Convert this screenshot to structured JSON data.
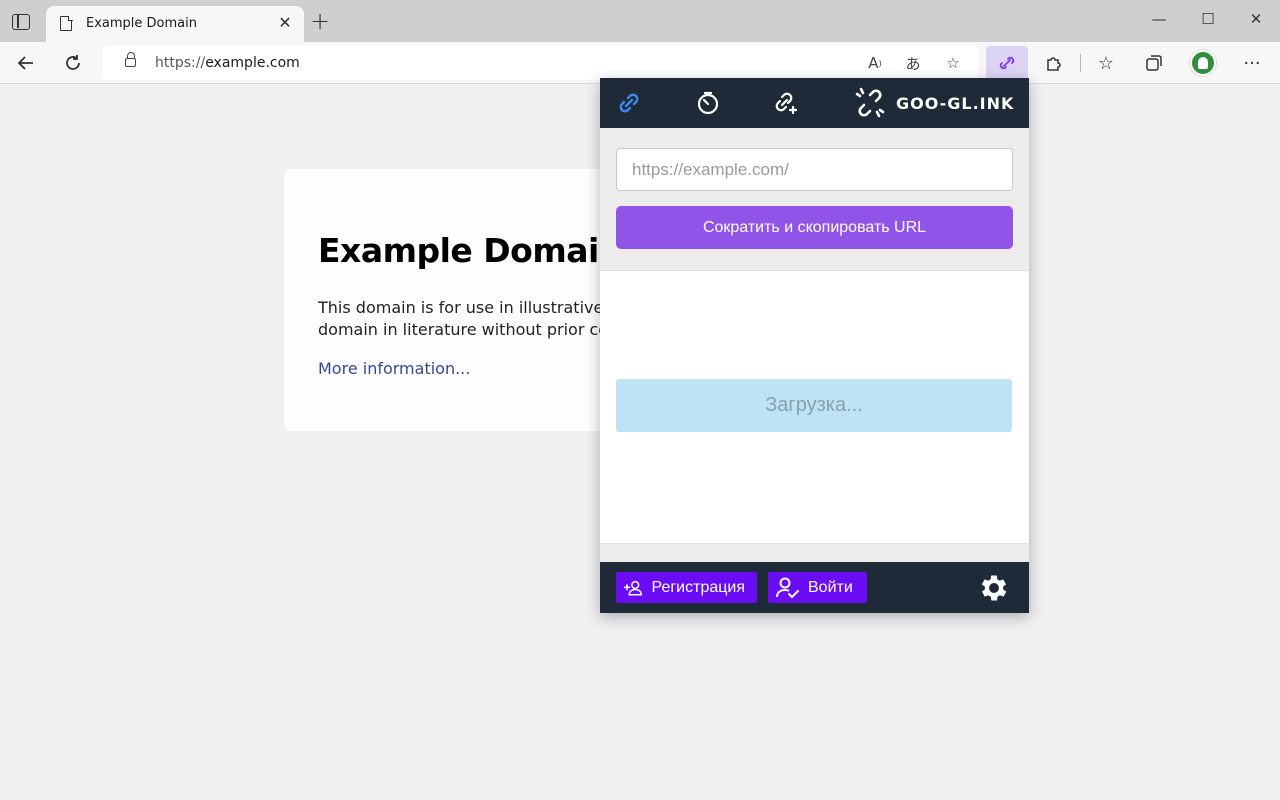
{
  "browser": {
    "tab_title": "Example Domain",
    "url_scheme": "https://",
    "url_host": "example.com"
  },
  "page": {
    "heading": "Example Domain",
    "paragraph_line1": "This domain is for use in illustrative ex",
    "paragraph_line2": "domain in literature without prior coo",
    "link": "More information..."
  },
  "popup": {
    "brand": "GOO-GL.INK",
    "input_placeholder": "https://example.com/",
    "shorten_button": "Сократить и скопировать URL",
    "loading_text": "Загрузка...",
    "register_button": "Регистрация",
    "login_button": "Войти"
  },
  "colors": {
    "accent_purple": "#9055e8",
    "footer_button": "#6a0df5",
    "header_bg": "#1f2a38",
    "active_link_icon": "#3f86f0"
  }
}
